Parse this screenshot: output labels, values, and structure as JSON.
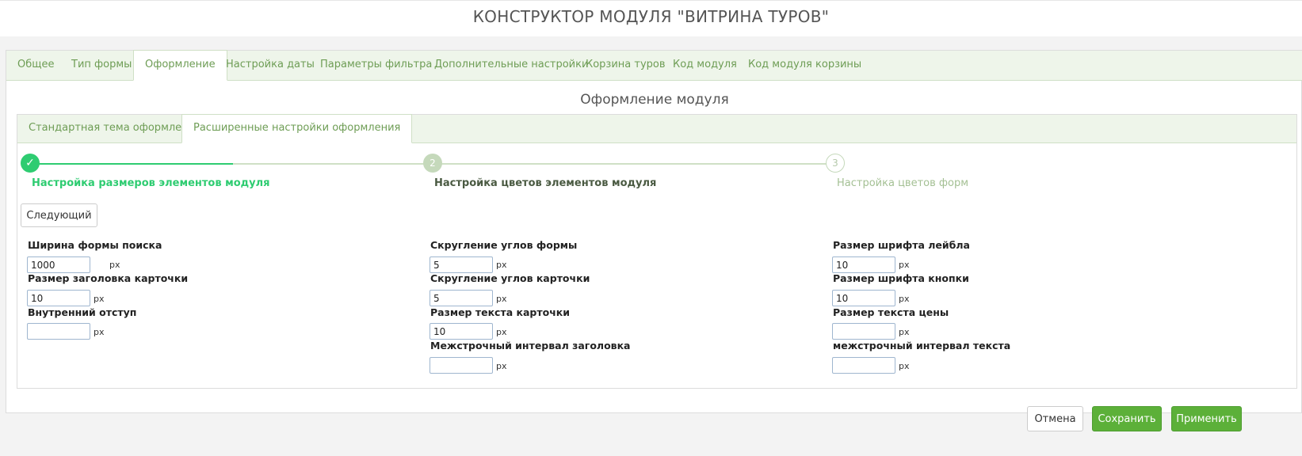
{
  "page": {
    "title": "КОНСТРУКТОР МОДУЛЯ \"ВИТРИНА ТУРОВ\""
  },
  "tabs": [
    {
      "label": "Общее"
    },
    {
      "label": "Тип формы"
    },
    {
      "label": "Оформление"
    },
    {
      "label": "Настройка даты"
    },
    {
      "label": "Параметры фильтра"
    },
    {
      "label": "Дополнительные настройки"
    },
    {
      "label": "Корзина туров"
    },
    {
      "label": "Код модуля"
    },
    {
      "label": "Код модуля корзины"
    }
  ],
  "active_tab": "Оформление",
  "section": {
    "title": "Оформление модуля"
  },
  "subtabs": [
    {
      "label": "Стандартная тема оформления"
    },
    {
      "label": "Расширенные настройки оформления"
    }
  ],
  "active_subtab": "Расширенные настройки оформления",
  "steps": [
    {
      "number": "✓",
      "label": "Настройка размеров элементов модуля",
      "state": "done"
    },
    {
      "number": "2",
      "label": "Настройка цветов элементов модуля",
      "state": "current"
    },
    {
      "number": "3",
      "label": "Настройка цветов форм",
      "state": "pending"
    }
  ],
  "next_button": "Следующий",
  "unit": "px",
  "fields": {
    "col1": [
      {
        "label": "Ширина формы поиска",
        "value": "1000"
      },
      {
        "label": "Размер заголовка карточки",
        "value": "10"
      },
      {
        "label": "Внутренний отступ",
        "value": ""
      }
    ],
    "col2": [
      {
        "label": "Скругление углов формы",
        "value": "5"
      },
      {
        "label": "Скругление углов карточки",
        "value": "5"
      },
      {
        "label": "Размер текста карточки",
        "value": "10"
      },
      {
        "label": "Межстрочный интервал заголовка",
        "value": ""
      }
    ],
    "col3": [
      {
        "label": "Размер шрифта лейбла",
        "value": "10"
      },
      {
        "label": "Размер шрифта кнопки",
        "value": "10"
      },
      {
        "label": "Размер текста цены",
        "value": ""
      },
      {
        "label": "межстрочный интервал текста",
        "value": ""
      }
    ]
  },
  "footer": {
    "cancel": "Отмена",
    "save": "Сохранить",
    "apply": "Применить"
  },
  "colors": {
    "accent": "#5cb039",
    "tab_text": "#6e9d55",
    "step_done": "#2ecc71",
    "tab_bg": "#eef5ea"
  }
}
